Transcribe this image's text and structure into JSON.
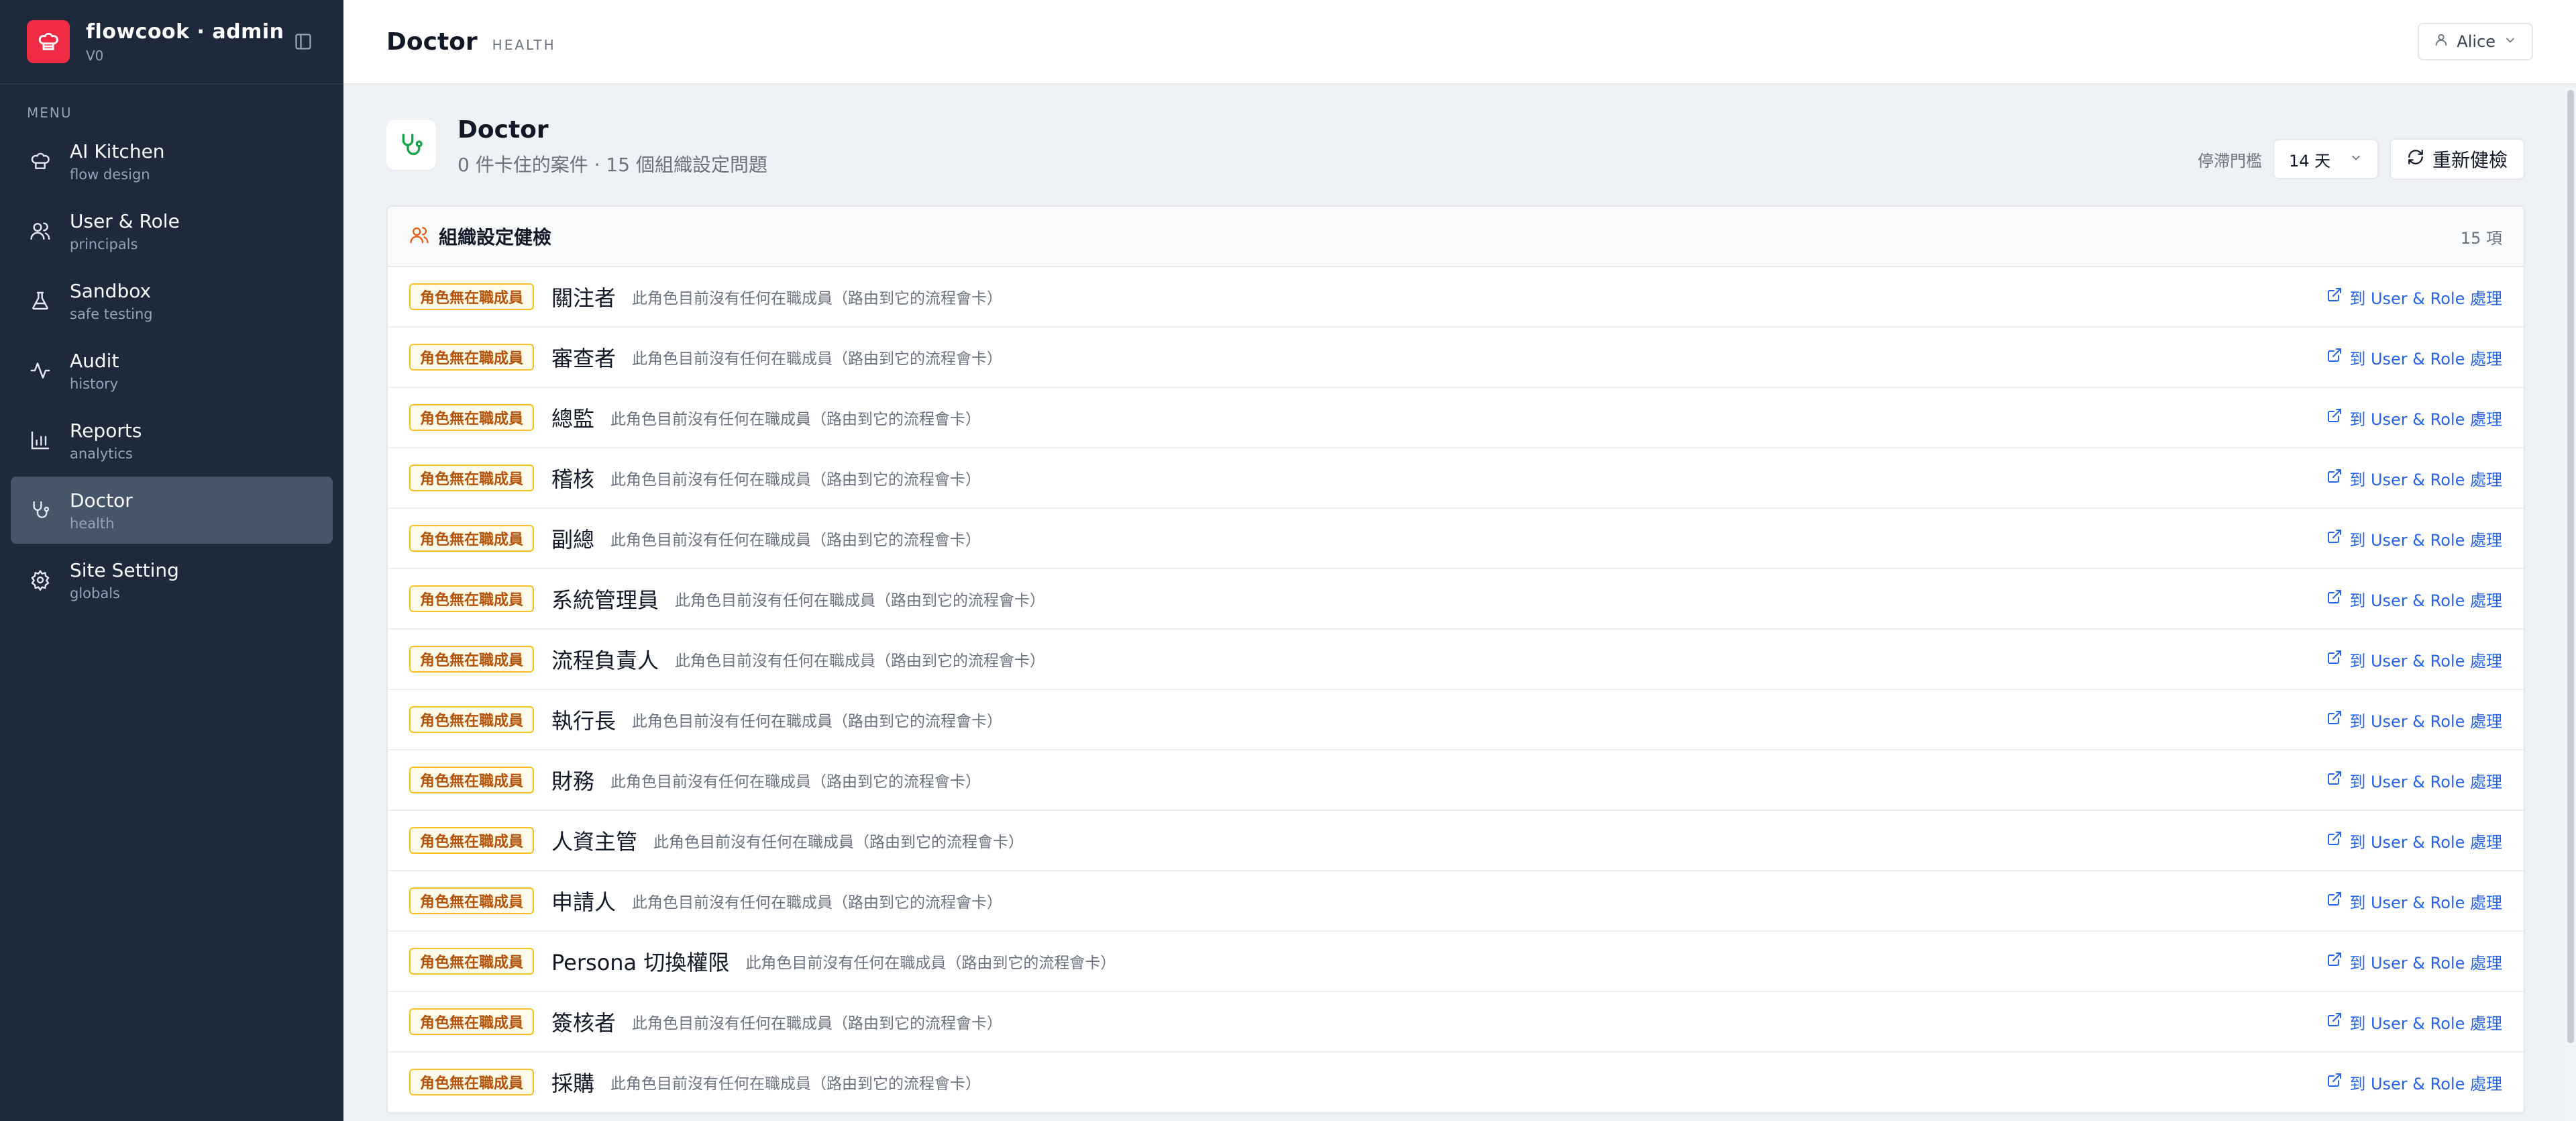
{
  "brand": {
    "title": "flowcook · admin",
    "version": "V0",
    "logo_icon": "chef-hat-icon"
  },
  "sidebar": {
    "menu_label": "MENU",
    "items": [
      {
        "label": "AI Kitchen",
        "sub": "flow design",
        "icon": "chef-hat-icon",
        "active": false
      },
      {
        "label": "User & Role",
        "sub": "principals",
        "icon": "users-icon",
        "active": false
      },
      {
        "label": "Sandbox",
        "sub": "safe testing",
        "icon": "flask-icon",
        "active": false
      },
      {
        "label": "Audit",
        "sub": "history",
        "icon": "activity-icon",
        "active": false
      },
      {
        "label": "Reports",
        "sub": "analytics",
        "icon": "bar-chart-icon",
        "active": false
      },
      {
        "label": "Doctor",
        "sub": "health",
        "icon": "stethoscope-icon",
        "active": true
      },
      {
        "label": "Site Setting",
        "sub": "globals",
        "icon": "gear-icon",
        "active": false
      }
    ]
  },
  "topbar": {
    "title": "Doctor",
    "subtitle": "HEALTH",
    "user": "Alice"
  },
  "page": {
    "title": "Doctor",
    "subtitle": "0 件卡住的案件 · 15 個組織設定問題",
    "threshold_label": "停滯門檻",
    "threshold_value": "14 天",
    "refresh_label": "重新健檢"
  },
  "card": {
    "title": "組織設定健檢",
    "count": "15 項",
    "rows": [
      {
        "badge": "角色無在職成員",
        "name": "關注者",
        "desc": "此角色目前沒有任何在職成員（路由到它的流程會卡）",
        "link": "到 User & Role 處理"
      },
      {
        "badge": "角色無在職成員",
        "name": "審查者",
        "desc": "此角色目前沒有任何在職成員（路由到它的流程會卡）",
        "link": "到 User & Role 處理"
      },
      {
        "badge": "角色無在職成員",
        "name": "總監",
        "desc": "此角色目前沒有任何在職成員（路由到它的流程會卡）",
        "link": "到 User & Role 處理"
      },
      {
        "badge": "角色無在職成員",
        "name": "稽核",
        "desc": "此角色目前沒有任何在職成員（路由到它的流程會卡）",
        "link": "到 User & Role 處理"
      },
      {
        "badge": "角色無在職成員",
        "name": "副總",
        "desc": "此角色目前沒有任何在職成員（路由到它的流程會卡）",
        "link": "到 User & Role 處理"
      },
      {
        "badge": "角色無在職成員",
        "name": "系統管理員",
        "desc": "此角色目前沒有任何在職成員（路由到它的流程會卡）",
        "link": "到 User & Role 處理"
      },
      {
        "badge": "角色無在職成員",
        "name": "流程負責人",
        "desc": "此角色目前沒有任何在職成員（路由到它的流程會卡）",
        "link": "到 User & Role 處理"
      },
      {
        "badge": "角色無在職成員",
        "name": "執行長",
        "desc": "此角色目前沒有任何在職成員（路由到它的流程會卡）",
        "link": "到 User & Role 處理"
      },
      {
        "badge": "角色無在職成員",
        "name": "財務",
        "desc": "此角色目前沒有任何在職成員（路由到它的流程會卡）",
        "link": "到 User & Role 處理"
      },
      {
        "badge": "角色無在職成員",
        "name": "人資主管",
        "desc": "此角色目前沒有任何在職成員（路由到它的流程會卡）",
        "link": "到 User & Role 處理"
      },
      {
        "badge": "角色無在職成員",
        "name": "申請人",
        "desc": "此角色目前沒有任何在職成員（路由到它的流程會卡）",
        "link": "到 User & Role 處理"
      },
      {
        "badge": "角色無在職成員",
        "name": "Persona 切換權限",
        "desc": "此角色目前沒有任何在職成員（路由到它的流程會卡）",
        "link": "到 User & Role 處理"
      },
      {
        "badge": "角色無在職成員",
        "name": "簽核者",
        "desc": "此角色目前沒有任何在職成員（路由到它的流程會卡）",
        "link": "到 User & Role 處理"
      },
      {
        "badge": "角色無在職成員",
        "name": "採購",
        "desc": "此角色目前沒有任何在職成員（路由到它的流程會卡）",
        "link": "到 User & Role 處理"
      }
    ]
  },
  "colors": {
    "sidebar_bg": "#1e293b",
    "brand": "#ef2b45",
    "accent": "#2563eb",
    "badge_text": "#b45309",
    "badge_border": "#fbbf24",
    "health_green": "#16a34a",
    "users_orange": "#ea580c"
  }
}
